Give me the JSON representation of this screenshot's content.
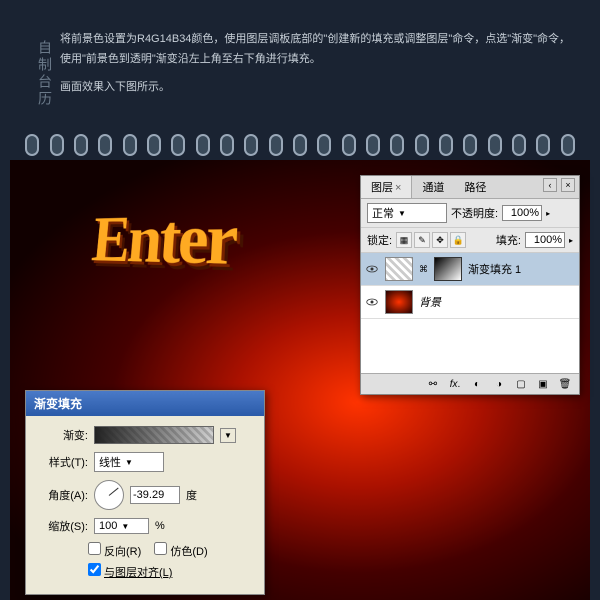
{
  "sidebar_title": "自制台历",
  "instructions": {
    "line1": "将前景色设置为R4G14B34颜色，使用图层调板底部的\"创建新的填充或调整图层\"命令，点选\"渐变\"命令，使用\"前景色到透明\"渐变沿左上角至右下角进行填充。",
    "line2": "画面效果入下图所示。"
  },
  "canvas_text": "Enter",
  "layers_panel": {
    "tabs": {
      "layers": "图层",
      "channels": "通道",
      "paths": "路径"
    },
    "blend_mode": "正常",
    "opacity_label": "不透明度:",
    "opacity_value": "100%",
    "lock_label": "锁定:",
    "fill_label": "填充:",
    "fill_value": "100%",
    "layer1_name": "渐变填充 1",
    "layer2_name": "背景"
  },
  "gradient_dialog": {
    "title": "渐变填充",
    "gradient_label": "渐变:",
    "style_label": "样式(T):",
    "style_value": "线性",
    "angle_label": "角度(A):",
    "angle_value": "-39.29",
    "angle_unit": "度",
    "scale_label": "缩放(S):",
    "scale_value": "100",
    "scale_unit": "%",
    "reverse": "反向(R)",
    "dither": "仿色(D)",
    "align": "与图层对齐(L)"
  }
}
